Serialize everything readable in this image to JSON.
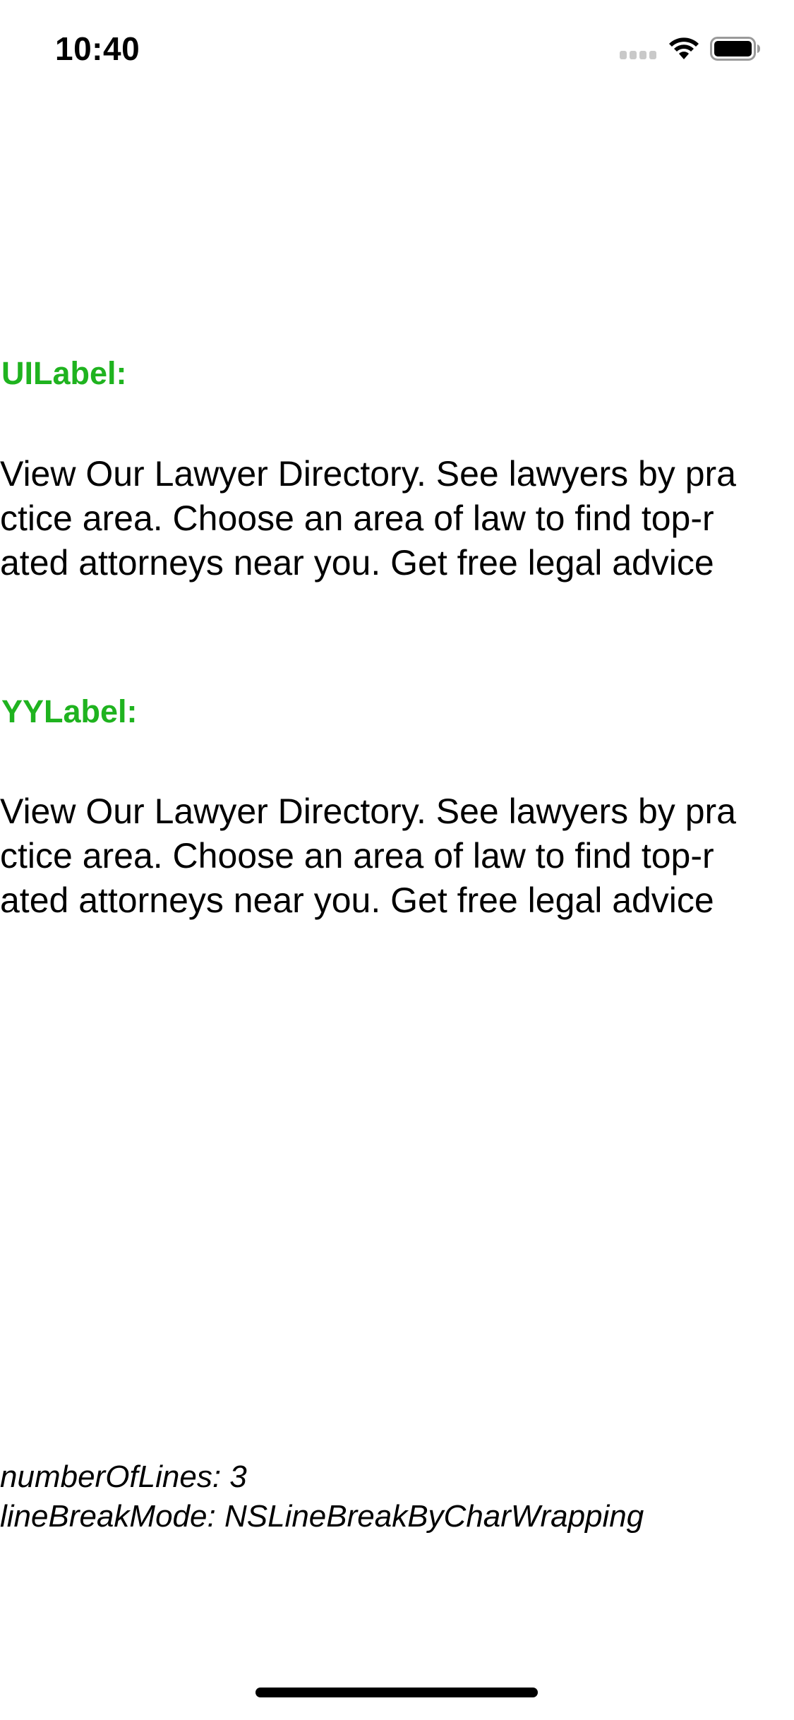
{
  "status_bar": {
    "time": "10:40"
  },
  "icons": {
    "signal": "cellular-signal-icon",
    "wifi": "wifi-icon",
    "battery": "battery-icon"
  },
  "colors": {
    "section_label": "#1fb31f",
    "text": "#000000",
    "background": "#ffffff"
  },
  "sections": [
    {
      "label": "UILabel:",
      "lines": [
        "View Our Lawyer Directory. See lawyers by pra",
        "ctice area. Choose an area of law to find top-r",
        "ated attorneys near you. Get free legal advice"
      ]
    },
    {
      "label": "YYLabel:",
      "lines": [
        "View Our Lawyer Directory. See lawyers by pra",
        "ctice area. Choose an area of law to find top-r",
        "ated attorneys near you. Get free legal advice"
      ]
    }
  ],
  "config": {
    "number_of_lines": "numberOfLines: 3",
    "line_break_mode": "lineBreakMode: NSLineBreakByCharWrapping"
  }
}
